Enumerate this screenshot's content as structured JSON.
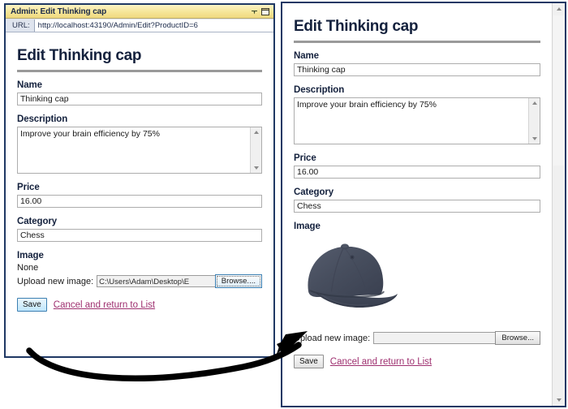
{
  "designer_window": {
    "titlebar": {
      "title": "Admin: Edit Thinking cap",
      "pin_icon": "chevron-down-pin-icon",
      "restore_icon": "restore-window-icon"
    },
    "url_bar": {
      "label": "URL:",
      "value": "http://localhost:43190/Admin/Edit?ProductID=6"
    },
    "form": {
      "heading": "Edit Thinking cap",
      "name": {
        "label": "Name",
        "value": "Thinking cap"
      },
      "description": {
        "label": "Description",
        "value": "Improve your brain efficiency by 75%"
      },
      "price": {
        "label": "Price",
        "value": "16.00"
      },
      "category": {
        "label": "Category",
        "value": "Chess"
      },
      "image": {
        "label": "Image",
        "current": "None",
        "upload_label": "Upload new image:",
        "file_value": "C:\\Users\\Adam\\Desktop\\E",
        "browse_label": "Browse...."
      },
      "save_label": "Save",
      "cancel_label": "Cancel and return to List"
    }
  },
  "browser_window": {
    "form": {
      "heading": "Edit Thinking cap",
      "name": {
        "label": "Name",
        "value": "Thinking cap"
      },
      "description": {
        "label": "Description",
        "value": "Improve your brain efficiency by 75%"
      },
      "price": {
        "label": "Price",
        "value": "16.00"
      },
      "category": {
        "label": "Category",
        "value": "Chess"
      },
      "image": {
        "label": "Image",
        "preview_alt": "baseball-cap-photo",
        "upload_label": "Upload new image:",
        "file_value": "",
        "browse_label": "Browse..."
      },
      "save_label": "Save",
      "cancel_label": "Cancel and return to List"
    },
    "scrollbar": {
      "up_icon": "scroll-up-arrow-icon",
      "down_icon": "scroll-down-arrow-icon"
    }
  },
  "annotation": {
    "arrow_icon": "curved-callout-arrow-icon"
  },
  "colors": {
    "window_border": "#1f3864",
    "titlebar_gold": "#f6e79b",
    "heading_navy": "#14213d",
    "link_magenta": "#9e2f6f",
    "cap_fabric": "#474e5e",
    "rule_gray": "#9a9a9a"
  }
}
